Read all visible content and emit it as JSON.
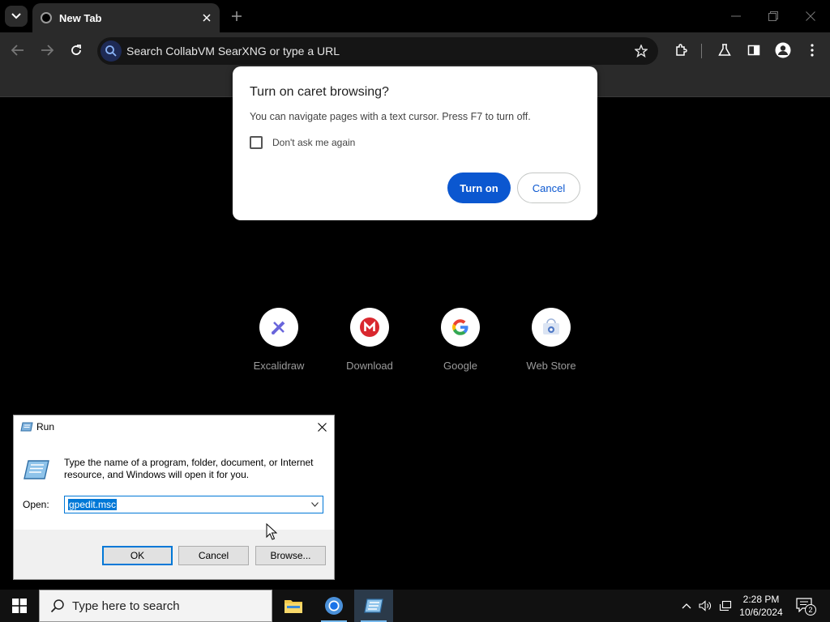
{
  "browser": {
    "tab": {
      "title": "New Tab"
    },
    "omnibox": {
      "placeholder": "Search CollabVM SearXNG or type a URL"
    }
  },
  "caret_dialog": {
    "title": "Turn on caret browsing?",
    "body": "You can navigate pages with a text cursor. Press F7 to turn off.",
    "checkbox_label": "Don't ask me again",
    "checked": false,
    "turn_on_label": "Turn on",
    "cancel_label": "Cancel"
  },
  "shortcuts": [
    {
      "label": "Excalidraw",
      "icon": "excalidraw-icon"
    },
    {
      "label": "Download",
      "icon": "mega-icon"
    },
    {
      "label": "Google",
      "icon": "google-icon"
    },
    {
      "label": "Web Store",
      "icon": "web-store-icon"
    }
  ],
  "run_dialog": {
    "title": "Run",
    "description": "Type the name of a program, folder, document, or Internet resource, and Windows will open it for you.",
    "open_label": "Open:",
    "open_value": "gpedit.msc",
    "ok_label": "OK",
    "cancel_label": "Cancel",
    "browse_label": "Browse..."
  },
  "taskbar": {
    "search_placeholder": "Type here to search",
    "time": "2:28 PM",
    "date": "10/6/2024",
    "notification_count": "2"
  },
  "colors": {
    "accent": "#0b57d0",
    "selection": "#0078d7"
  }
}
